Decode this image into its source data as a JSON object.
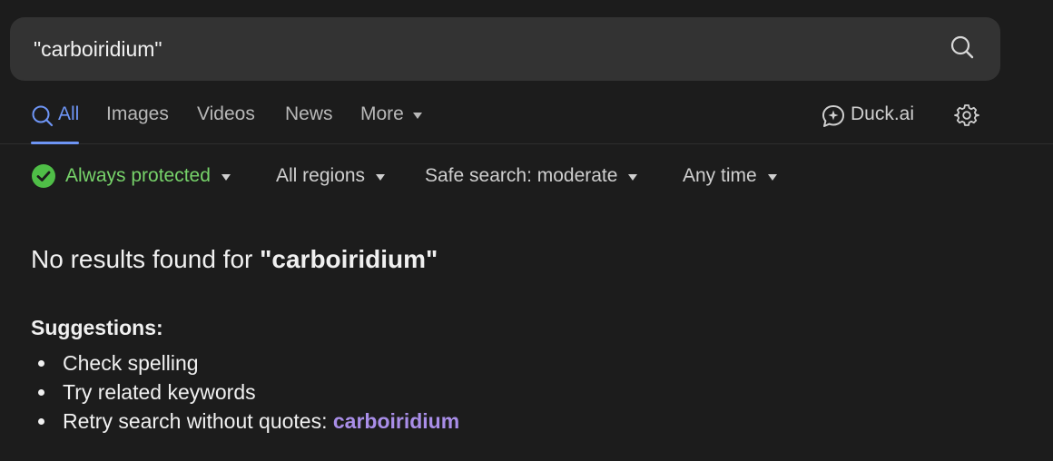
{
  "search": {
    "value": "\"carboiridium\"",
    "placeholder": ""
  },
  "tabs": [
    {
      "label": "All",
      "active": true
    },
    {
      "label": "Images"
    },
    {
      "label": "Videos"
    },
    {
      "label": "News"
    },
    {
      "label": "More"
    }
  ],
  "duckai_label": "Duck.ai",
  "filters": {
    "protection": "Always protected",
    "region": "All regions",
    "safe_search": "Safe search: moderate",
    "time": "Any time"
  },
  "results": {
    "no_results_prefix": "No results found for ",
    "query_display": "\"carboiridium\"",
    "suggestions_title": "Suggestions:",
    "suggestions": [
      "Check spelling",
      "Try related keywords",
      "Retry search without quotes: "
    ],
    "retry_link": "carboiridium"
  },
  "colors": {
    "background": "#1c1c1c",
    "searchbar": "#333333",
    "accent_blue": "#6e95f5",
    "protected_green": "#77d36a",
    "link_purple": "#a98ee8"
  },
  "icons": {
    "search": "search-icon",
    "tab_all": "search-icon",
    "duckai": "chat-sparkle-icon",
    "settings": "gear-icon",
    "protected": "check-circle-icon"
  }
}
